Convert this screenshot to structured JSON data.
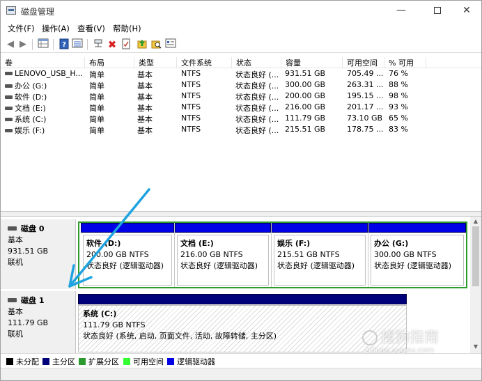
{
  "window": {
    "title": "磁盘管理"
  },
  "menu": [
    "文件(F)",
    "操作(A)",
    "查看(V)",
    "帮助(H)"
  ],
  "columns": [
    "卷",
    "布局",
    "类型",
    "文件系统",
    "状态",
    "容量",
    "可用空间",
    "% 可用"
  ],
  "volumes": [
    [
      "LENOVO_USB_H...",
      "简单",
      "基本",
      "NTFS",
      "状态良好 (...",
      "931.51 GB",
      "705.49 ...",
      "76 %"
    ],
    [
      "办公 (G:)",
      "简单",
      "基本",
      "NTFS",
      "状态良好 (...",
      "300.00 GB",
      "263.31 ...",
      "88 %"
    ],
    [
      "软件 (D:)",
      "简单",
      "基本",
      "NTFS",
      "状态良好 (...",
      "200.00 GB",
      "195.15 ...",
      "98 %"
    ],
    [
      "文档 (E:)",
      "简单",
      "基本",
      "NTFS",
      "状态良好 (...",
      "216.00 GB",
      "201.17 ...",
      "93 %"
    ],
    [
      "系统 (C:)",
      "简单",
      "基本",
      "NTFS",
      "状态良好 (...",
      "111.79 GB",
      "73.10 GB",
      "65 %"
    ],
    [
      "娱乐 (F:)",
      "简单",
      "基本",
      "NTFS",
      "状态良好 (...",
      "215.51 GB",
      "178.75 ...",
      "83 %"
    ]
  ],
  "disks": [
    {
      "name": "磁盘 0",
      "type": "基本",
      "size": "931.51 GB",
      "status": "联机",
      "partitions": [
        {
          "name": "软件 (D:)",
          "size": "200.00 GB NTFS",
          "status": "状态良好 (逻辑驱动器)"
        },
        {
          "name": "文档 (E:)",
          "size": "216.00 GB NTFS",
          "status": "状态良好 (逻辑驱动器)"
        },
        {
          "name": "娱乐 (F:)",
          "size": "215.51 GB NTFS",
          "status": "状态良好 (逻辑驱动器)"
        },
        {
          "name": "办公 (G:)",
          "size": "300.00 GB NTFS",
          "status": "状态良好 (逻辑驱动器)"
        }
      ]
    },
    {
      "name": "磁盘 1",
      "type": "基本",
      "size": "111.79 GB",
      "status": "联机",
      "partitions": [
        {
          "name": "系统 (C:)",
          "size": "111.79 GB NTFS",
          "status": "状态良好 (系统, 启动, 页面文件, 活动, 故障转储, 主分区)"
        }
      ]
    }
  ],
  "legend": [
    {
      "label": "未分配",
      "color": "#000000"
    },
    {
      "label": "主分区",
      "color": "#00007a"
    },
    {
      "label": "扩展分区",
      "color": "#2c9a2c"
    },
    {
      "label": "可用空间",
      "color": "#33ff33"
    },
    {
      "label": "逻辑驱动器",
      "color": "#0000e6"
    }
  ],
  "watermark": {
    "main": "搜狗指南",
    "sub": "zhinan.sogou.com"
  },
  "colors": {
    "annotation_arrow": "#1fa3e0",
    "logical_bar": "#0000e6",
    "primary_bar": "#00007a",
    "extended_frame": "#2c9a2c"
  }
}
